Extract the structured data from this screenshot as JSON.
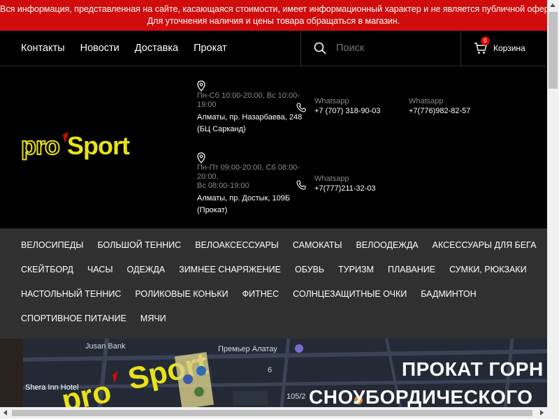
{
  "notice": {
    "line1": "Вся информация, представленная на сайте, касающаяся стоимости, имеет информационный характер и не является публичной офертой.",
    "line2": "Для уточнения наличия и цены товара обращаться в магазин."
  },
  "topnav": {
    "links": [
      "Контакты",
      "Новости",
      "Доставка",
      "Прокат"
    ],
    "search_placeholder": "Поиск",
    "cart_label": "Корзина",
    "cart_count": "0"
  },
  "header": {
    "logo_alt": "pro sport",
    "stores": [
      {
        "hours": "Пн-Сб 10:00-20:00, Вс 10:00-19:00",
        "address": "Алматы, пр. Назарбаева, 248 (БЦ Сарканд)"
      },
      {
        "hours_line1": "Пн-Пт 09:00-20:00, Сб 08:00-20:00,",
        "hours_line2": "Вс 08:00-19:00",
        "address": "Алматы, пр. Достык, 109Б (Прокат)"
      }
    ],
    "phones": [
      {
        "label": "Whatsapp",
        "number": "+7 (707) 318-90-03"
      },
      {
        "label": "Whatsapp",
        "number": "+7(776)982-82-57"
      },
      {
        "label": "Whatsapp",
        "number": "+7(777)211-32-03"
      }
    ]
  },
  "categories": {
    "row1": [
      "ВЕЛОСИПЕДЫ",
      "БОЛЬШОЙ ТЕННИС",
      "ВЕЛОАКСЕССУАРЫ",
      "САМОКАТЫ",
      "ВЕЛООДЕЖДА",
      "АКСЕССУАРЫ ДЛЯ БЕГА"
    ],
    "row2": [
      "СКЕЙТБОРД",
      "ЧАСЫ",
      "ОДЕЖДА",
      "ЗИМНЕЕ СНАРЯЖЕНИЕ",
      "ОБУВЬ",
      "ТУРИЗМ",
      "ПЛАВАНИЕ",
      "СУМКИ, РЮКЗАКИ"
    ],
    "row3": [
      "НАСТОЛЬНЫЙ ТЕННИС",
      "РОЛИКОВЫЕ КОНЬКИ",
      "ФИТНЕС",
      "СОЛНЦЕЗАЩИТНЫЕ ОЧКИ",
      "БАДМИНТОН"
    ],
    "row4": [
      "СПОРТИВНОЕ ПИТАНИЕ",
      "МЯЧИ"
    ]
  },
  "banner": {
    "title_line1": "ПРОКАТ ГОРН",
    "title_line2": "СНОУБОРДИЧЕСКОГО",
    "map_labels": [
      "Jusan Bank",
      "Премьер Алатау",
      "Shera Inn Hotel",
      "6",
      "105/2"
    ]
  },
  "colors": {
    "notice_bg": "#d10c0c",
    "header_bg": "#000000",
    "category_bg": "#303030",
    "logo_yellow": "#e8e21a",
    "logo_red": "#d10c0c"
  }
}
